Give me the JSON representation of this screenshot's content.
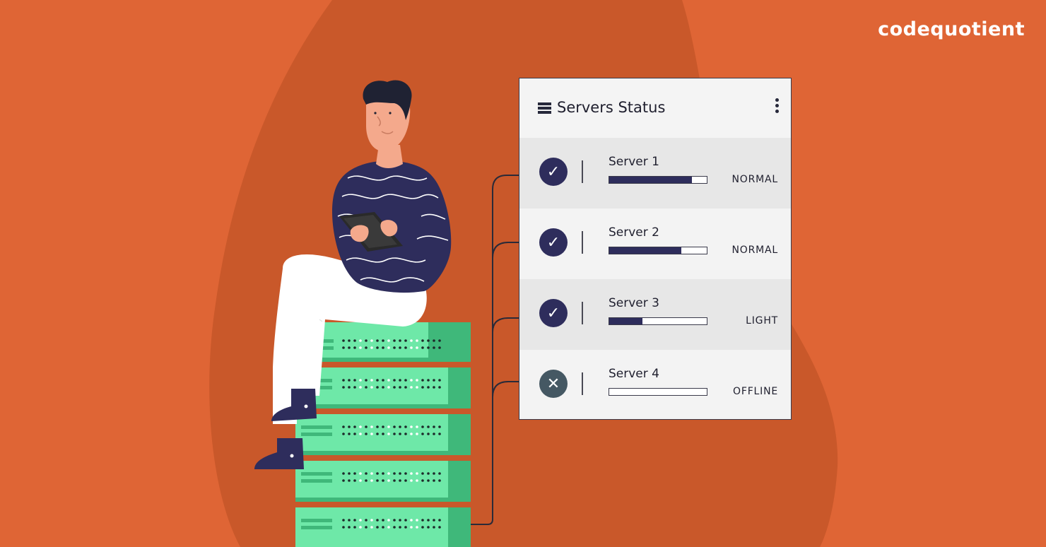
{
  "brand": {
    "logo_text": "codequotient"
  },
  "panel": {
    "title": "Servers Status",
    "header_icon": "server-stack-icon",
    "menu_icon": "more-vertical-icon",
    "servers": [
      {
        "name": "Server 1",
        "status": "NORMAL",
        "load": 0.85,
        "state_icon": "check-icon"
      },
      {
        "name": "Server 2",
        "status": "NORMAL",
        "load": 0.74,
        "state_icon": "check-icon"
      },
      {
        "name": "Server 3",
        "status": "LIGHT",
        "load": 0.34,
        "state_icon": "check-icon"
      },
      {
        "name": "Server 4",
        "status": "OFFLINE",
        "load": 0.0,
        "state_icon": "close-icon"
      }
    ]
  },
  "colors": {
    "background": "#df6535",
    "blob": "#c9582a",
    "navy": "#2e2d5c",
    "server_green": "#6ee8a8",
    "server_dark_green": "#3fb87a"
  }
}
